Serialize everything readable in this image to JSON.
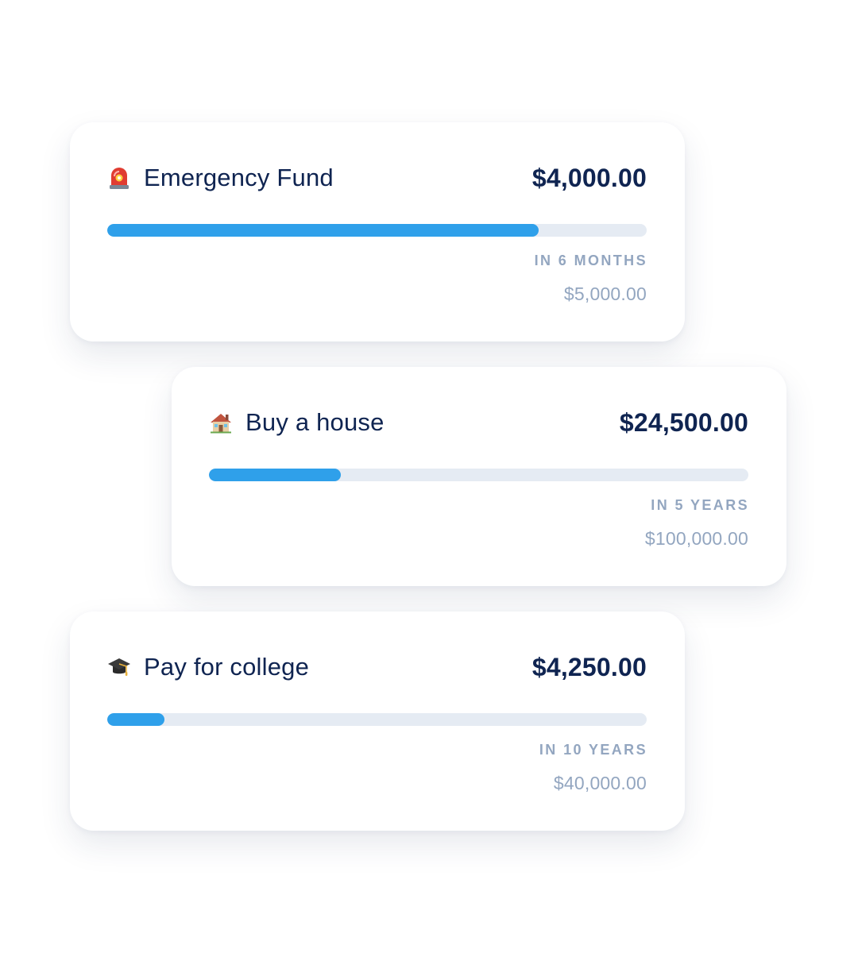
{
  "colors": {
    "accent": "#2fa0ea",
    "track": "#e5ebf3",
    "primary_text": "#0f2451",
    "muted_text": "#93a6c0"
  },
  "goals": [
    {
      "icon": "rotating-light-icon",
      "name": "Emergency Fund",
      "saved": "$4,000.00",
      "timeframe": "IN 6 MONTHS",
      "target": "$5,000.00",
      "progress": 0.8
    },
    {
      "icon": "house-icon",
      "name": "Buy a house",
      "saved": "$24,500.00",
      "timeframe": "IN 5 YEARS",
      "target": "$100,000.00",
      "progress": 0.245
    },
    {
      "icon": "graduation-cap-icon",
      "name": "Pay for college",
      "saved": "$4,250.00",
      "timeframe": "IN 10 YEARS",
      "target": "$40,000.00",
      "progress": 0.106
    }
  ]
}
